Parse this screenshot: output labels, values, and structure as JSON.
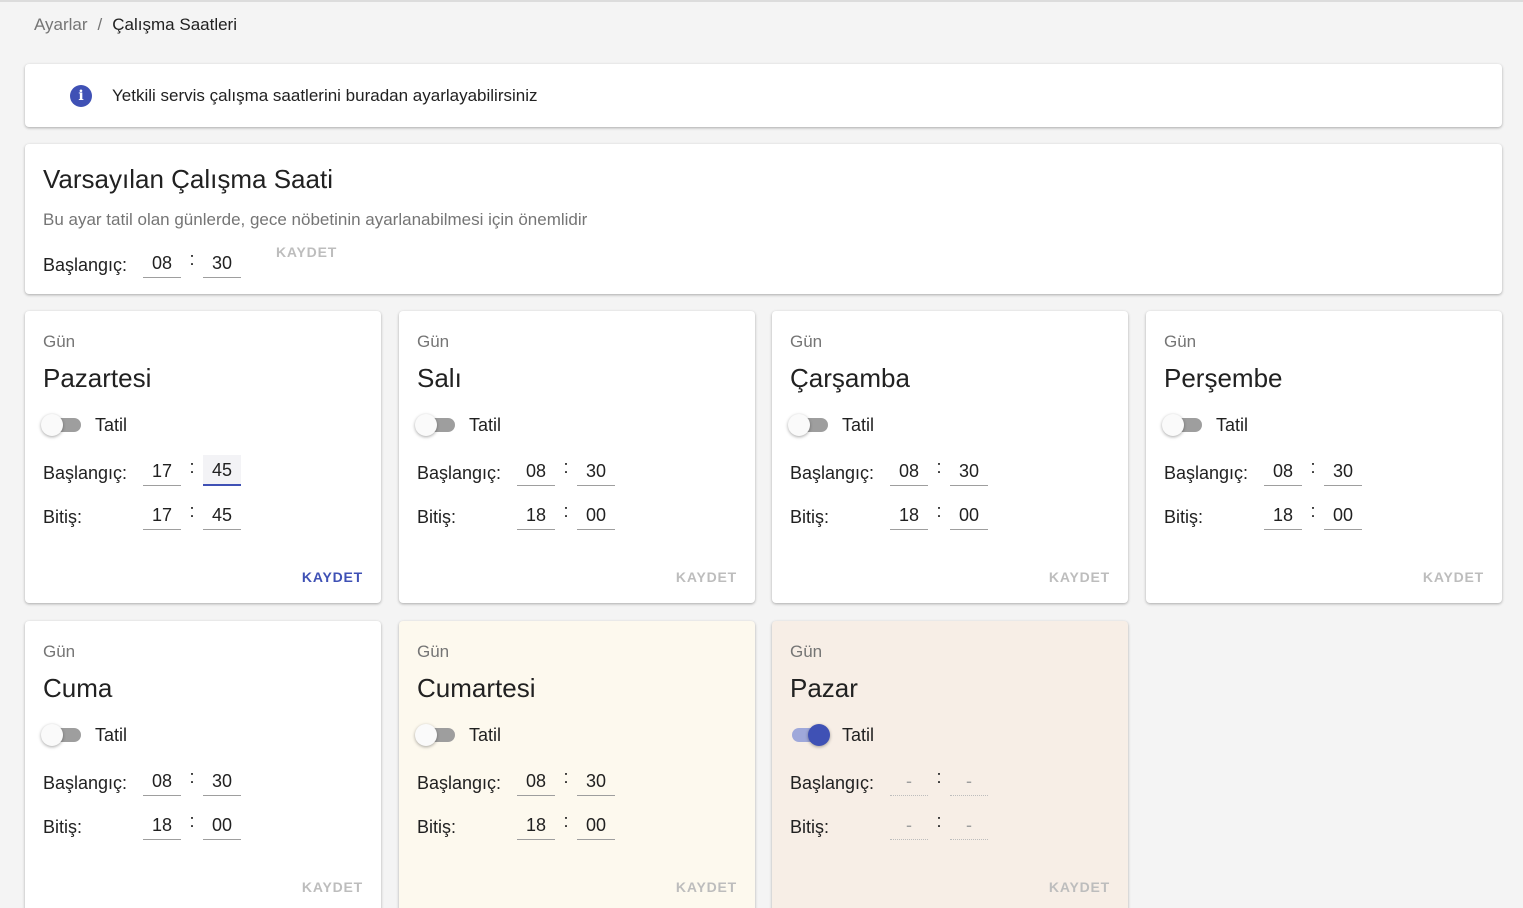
{
  "breadcrumb": {
    "parent": "Ayarlar",
    "separator": "/",
    "current": "Çalışma Saatleri"
  },
  "info": {
    "icon": "info-icon",
    "text": "Yetkili servis çalışma saatlerini buradan ayarlayabilirsiniz"
  },
  "default_hours": {
    "title": "Varsayılan Çalışma Saati",
    "subtitle": "Bu ayar tatil olan günlerde, gece nöbetinin ayarlanabilmesi için önemlidir",
    "start_label": "Başlangıç:",
    "hour": "08",
    "minute": "30",
    "save_label": "KAYDET"
  },
  "labels": {
    "day_caption": "Gün",
    "holiday": "Tatil",
    "start": "Başlangıç:",
    "end": "Bitiş:",
    "save": "KAYDET",
    "colon": ":"
  },
  "days": [
    {
      "name": "Pazartesi",
      "holiday": false,
      "start_h": "17",
      "start_m": "45",
      "end_h": "17",
      "end_m": "45",
      "save_active": true
    },
    {
      "name": "Salı",
      "holiday": false,
      "start_h": "08",
      "start_m": "30",
      "end_h": "18",
      "end_m": "00",
      "save_active": false
    },
    {
      "name": "Çarşamba",
      "holiday": false,
      "start_h": "08",
      "start_m": "30",
      "end_h": "18",
      "end_m": "00",
      "save_active": false
    },
    {
      "name": "Perşembe",
      "holiday": false,
      "start_h": "08",
      "start_m": "30",
      "end_h": "18",
      "end_m": "00",
      "save_active": false
    },
    {
      "name": "Cuma",
      "holiday": false,
      "start_h": "08",
      "start_m": "30",
      "end_h": "18",
      "end_m": "00",
      "save_active": false
    },
    {
      "name": "Cumartesi",
      "holiday": false,
      "start_h": "08",
      "start_m": "30",
      "end_h": "18",
      "end_m": "00",
      "save_active": false
    },
    {
      "name": "Pazar",
      "holiday": true,
      "start_h": "-",
      "start_m": "-",
      "end_h": "-",
      "end_m": "-",
      "save_active": false
    }
  ],
  "colors": {
    "accent": "#3f51b5",
    "saturday_bg": "#fdf9ee",
    "sunday_bg": "#f7eee6"
  }
}
